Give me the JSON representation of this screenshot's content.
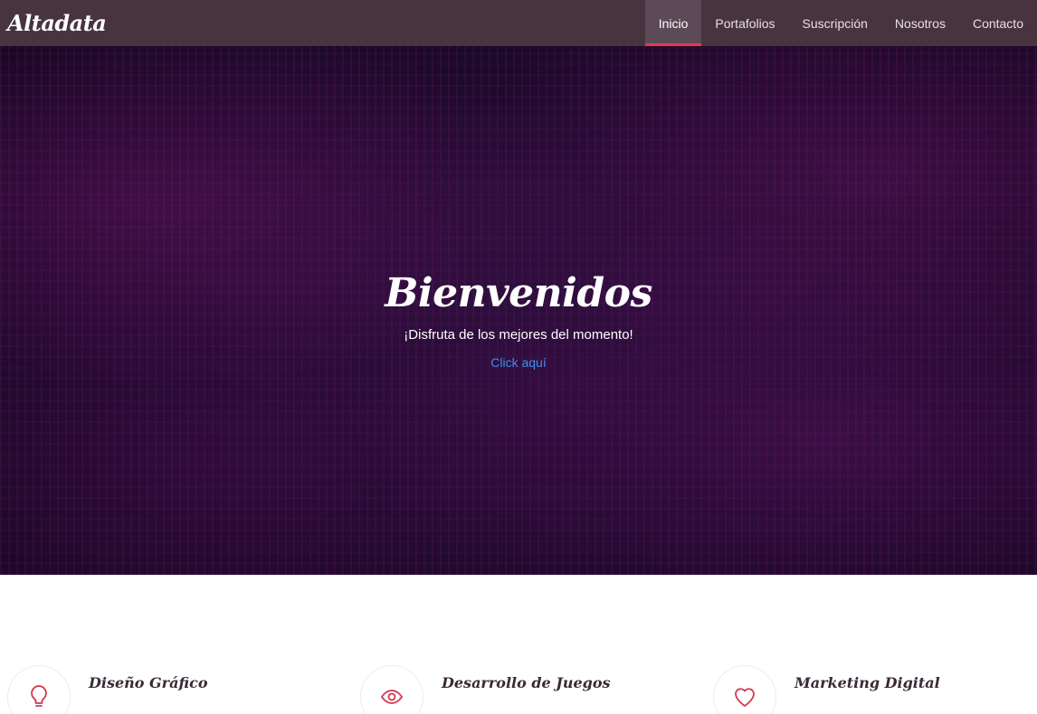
{
  "brand": {
    "name": "Altadata"
  },
  "nav": {
    "items": [
      {
        "label": "Inicio",
        "active": true
      },
      {
        "label": "Portafolios"
      },
      {
        "label": "Suscripción"
      },
      {
        "label": "Nosotros"
      },
      {
        "label": "Contacto"
      }
    ]
  },
  "hero": {
    "title": "Bienvenidos",
    "subtitle": "¡Disfruta de los mejores del momento!",
    "link": "Click aquí"
  },
  "services": [
    {
      "title": "Diseño Gráfico",
      "icon": "lightbulb-icon"
    },
    {
      "title": "Desarrollo de Juegos",
      "icon": "eye-icon"
    },
    {
      "title": "Marketing Digital",
      "icon": "heart-icon"
    }
  ],
  "colors": {
    "navbar_bg": "#47343f",
    "nav_active_bg": "#5c4a56",
    "accent": "#e23a4e",
    "link": "#3d8ff0",
    "hero_bg": "#1d0a2c",
    "icon_color": "#d3384e"
  }
}
